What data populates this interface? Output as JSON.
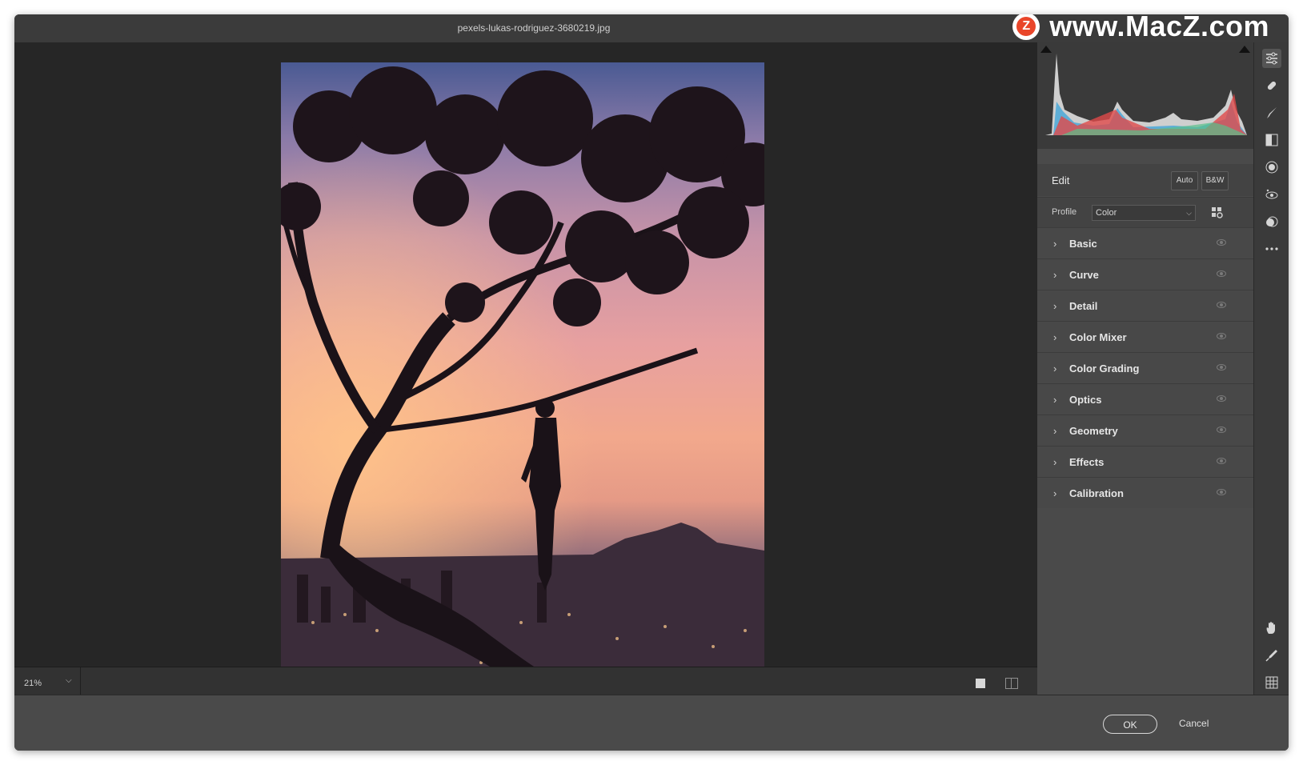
{
  "window": {
    "title": "pexels-lukas-rodriguez-3680219.jpg"
  },
  "watermark": {
    "logo_letter": "Z",
    "text": "www.MacZ.com"
  },
  "canvas": {
    "zoom": "21%"
  },
  "panel": {
    "edit_label": "Edit",
    "auto_label": "Auto",
    "bw_label": "B&W",
    "profile_label": "Profile",
    "profile_value": "Color",
    "sections": [
      {
        "label": "Basic"
      },
      {
        "label": "Curve"
      },
      {
        "label": "Detail"
      },
      {
        "label": "Color Mixer"
      },
      {
        "label": "Color Grading"
      },
      {
        "label": "Optics"
      },
      {
        "label": "Geometry"
      },
      {
        "label": "Effects"
      },
      {
        "label": "Calibration"
      }
    ]
  },
  "tools": {
    "top": [
      "edit-sliders-icon",
      "healing-icon",
      "brush-icon",
      "linear-gradient-icon",
      "radial-gradient-icon",
      "red-eye-icon",
      "presets-icon",
      "more-icon"
    ],
    "bottom": [
      "hand-icon",
      "color-sampler-icon",
      "grid-icon"
    ]
  },
  "footer": {
    "ok_label": "OK",
    "cancel_label": "Cancel"
  }
}
